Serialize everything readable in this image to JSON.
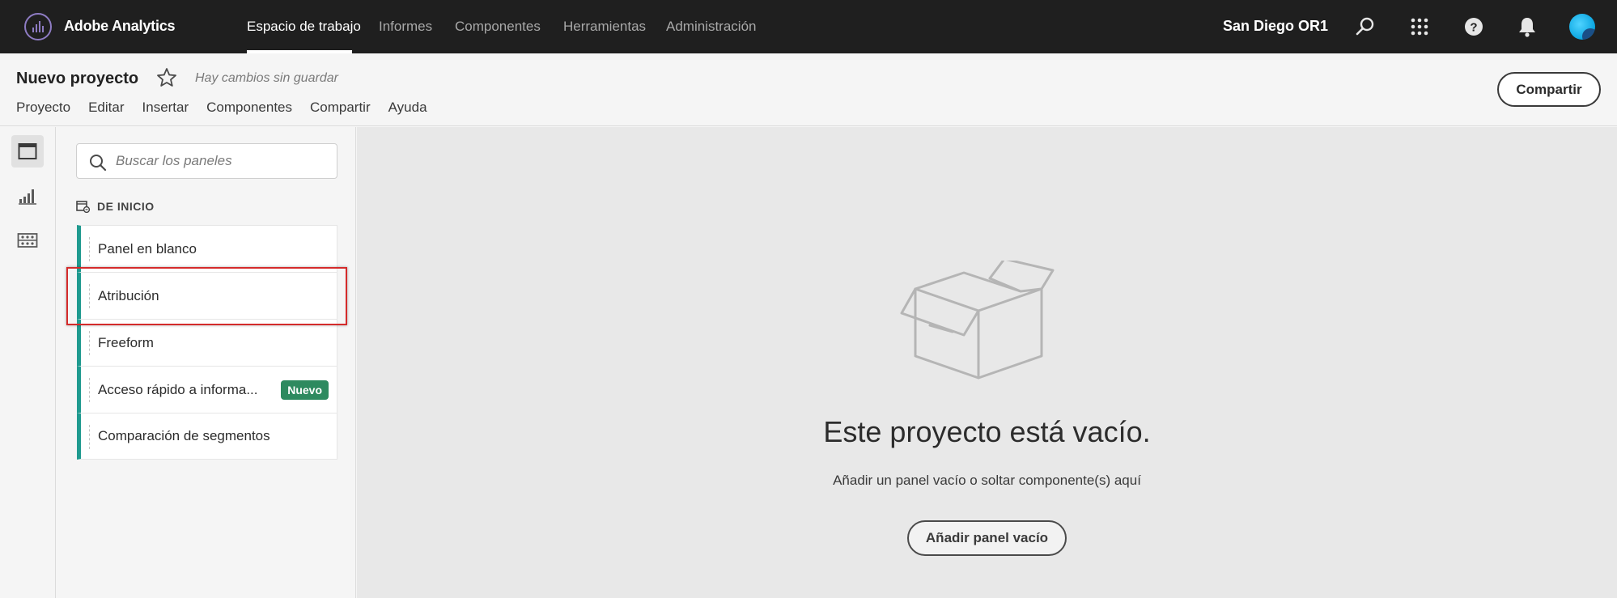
{
  "app": {
    "name": "Adobe Analytics"
  },
  "topnav": {
    "items": [
      "Espacio de trabajo",
      "Informes",
      "Componentes",
      "Herramientas",
      "Administración"
    ],
    "active_index": 0,
    "org": "San Diego OR1",
    "icons": [
      "search-icon",
      "apps-grid-icon",
      "help-icon",
      "notifications-bell-icon",
      "user-avatar"
    ]
  },
  "project": {
    "title": "Nuevo proyecto",
    "unsaved": "Hay cambios sin guardar",
    "menu": [
      "Proyecto",
      "Editar",
      "Insertar",
      "Componentes",
      "Compartir",
      "Ayuda"
    ],
    "share_label": "Compartir"
  },
  "rail": {
    "icons": [
      "panels-icon",
      "visualizations-icon",
      "components-icon"
    ],
    "active_index": 0
  },
  "panels": {
    "search_placeholder": "Buscar los paneles",
    "section": "DE INICIO",
    "items": [
      {
        "label": "Panel en blanco"
      },
      {
        "label": "Atribución",
        "highlighted": true
      },
      {
        "label": "Freeform"
      },
      {
        "label": "Acceso rápido a informa...",
        "badge": "Nuevo"
      },
      {
        "label": "Comparación de segmentos"
      }
    ]
  },
  "canvas": {
    "title": "Este proyecto está vacío.",
    "subtitle": "Añadir un panel vacío o soltar componente(s) aquí",
    "button": "Añadir panel vacío"
  },
  "colors": {
    "topbar": "#1f1f1f",
    "accent_teal": "#1f9a8f",
    "badge_green": "#2d8a5f",
    "highlight_red": "#d42b2b"
  }
}
